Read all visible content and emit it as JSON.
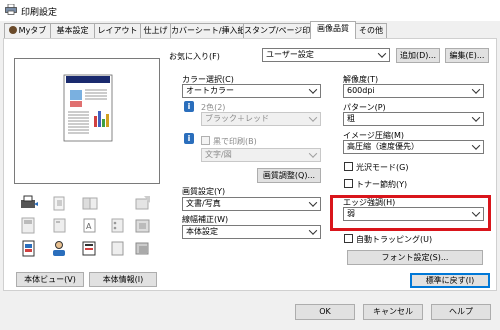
{
  "window": {
    "title": "印刷設定"
  },
  "tabs": [
    {
      "label": "Myタブ",
      "active": false
    },
    {
      "label": "基本設定",
      "active": false
    },
    {
      "label": "レイアウト",
      "active": false
    },
    {
      "label": "仕上げ",
      "active": false
    },
    {
      "label": "カバーシート/挿入紙",
      "active": false
    },
    {
      "label": "スタンプ/ページ印字",
      "active": false
    },
    {
      "label": "画像品質",
      "active": true
    },
    {
      "label": "その他",
      "active": false
    }
  ],
  "favorites": {
    "label": "お気に入り(F)",
    "value": "ユーザー設定",
    "add_label": "追加(D)...",
    "edit_label": "編集(E)..."
  },
  "left_buttons": {
    "view_label": "本体ビュー(V)",
    "info_label": "本体情報(I)"
  },
  "color": {
    "label": "カラー選択(C)",
    "value": "オートカラー",
    "two_color_label": "2色(2)",
    "two_color_value": "ブラック＋レッド",
    "black_print_label": "黒で印刷(B)",
    "black_print_value": "文字/図",
    "adjust_label": "画質調整(Q)..."
  },
  "image_setting": {
    "label": "画質設定(Y)",
    "value": "文書/写真"
  },
  "gamma": {
    "label": "線幅補正(W)",
    "value": "本体設定"
  },
  "resolution": {
    "label": "解像度(T)",
    "value": "600dpi"
  },
  "pattern": {
    "label": "パターン(P)",
    "value": "粗"
  },
  "compression": {
    "label": "イメージ圧縮(M)",
    "value": "高圧縮（速度優先）"
  },
  "glossy": {
    "label": "光沢モード(G)",
    "checked": false
  },
  "toner_save": {
    "label": "トナー節約(Y)",
    "checked": false
  },
  "edge": {
    "label": "エッジ強調(H)",
    "value": "弱"
  },
  "auto_trapping": {
    "label": "自動トラッピング(U)",
    "checked": false
  },
  "font_label": "フォント設定(S)...",
  "restore_label": "標準に戻す(I)",
  "footer": {
    "ok_label": "OK",
    "cancel_label": "キャンセル",
    "help_label": "ヘルプ"
  },
  "colors": {
    "accent": "#0078d7",
    "highlight": "#d9151b",
    "info": "#2a6ebc"
  },
  "icons": {
    "info": "i"
  }
}
